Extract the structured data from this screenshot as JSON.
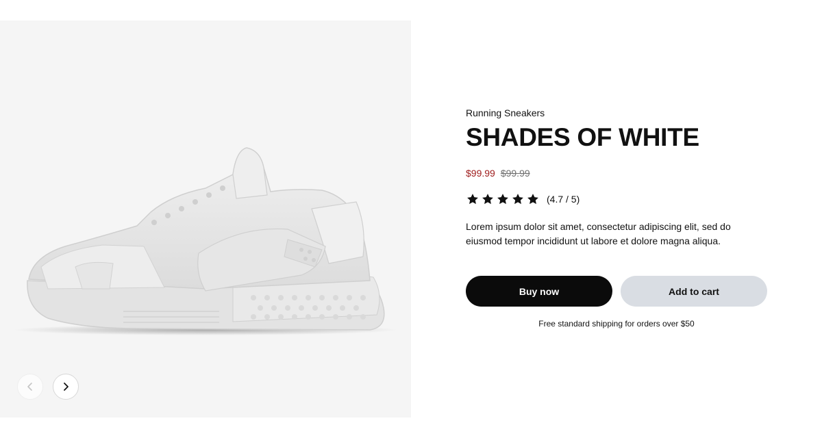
{
  "product": {
    "category": "Running Sneakers",
    "title": "SHADES OF WHITE",
    "price": {
      "sale": "$99.99",
      "original": "$99.99",
      "sale_color": "#9e1b1b"
    },
    "rating": {
      "value": 4.7,
      "max": 5,
      "stars_filled": 5,
      "text": "(4.7 / 5)"
    },
    "description": "Lorem ipsum dolor sit amet, consectetur adipiscing elit, sed do eiusmod tempor incididunt ut labore et dolore magna aliqua.",
    "image": {
      "icon": "white-sneaker-image"
    }
  },
  "gallery": {
    "prev_icon": "chevron-left-icon",
    "next_icon": "chevron-right-icon"
  },
  "actions": {
    "buy_label": "Buy now",
    "cart_label": "Add to cart"
  },
  "shipping_note": "Free standard shipping for orders over $50",
  "colors": {
    "primary_button": "#0b0b0b",
    "secondary_button": "#d9dde3",
    "media_background": "#f5f5f5"
  }
}
